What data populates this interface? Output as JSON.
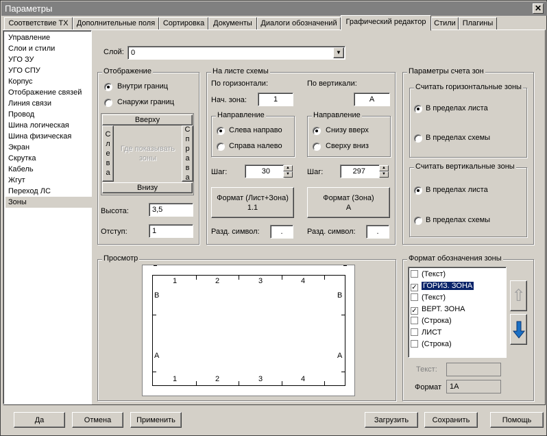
{
  "window": {
    "title": "Параметры",
    "close": "✕"
  },
  "tabs": [
    "Соответствие ТХ",
    "Дополнительные поля",
    "Сортировка",
    "Документы",
    "Диалоги обозначений",
    "Графический редактор",
    "Стили",
    "Плагины"
  ],
  "active_tab": "Графический редактор",
  "nav": [
    "Управление",
    "Слои и стили",
    "УГО ЗУ",
    "УГО СПУ",
    "Корпус",
    "Отображение связей",
    "Линия связи",
    "Провод",
    "Шина логическая",
    "Шина физическая",
    "Экран",
    "Скрутка",
    "Кабель",
    "Жгут",
    "Переход ЛС",
    "Зоны"
  ],
  "nav_selected": "Зоны",
  "layer": {
    "label": "Слой:",
    "value": "0"
  },
  "display": {
    "title": "Отображение",
    "inside": "Внутри границ",
    "outside": "Снаружи границ",
    "top": "Вверху",
    "left": "Слева",
    "right": "Справа",
    "bottom": "Внизу",
    "center": "Где показывать зоны",
    "height_label": "Высота:",
    "height_value": "3,5",
    "indent_label": "Отступ:",
    "indent_value": "1"
  },
  "sheet": {
    "title": "На листе схемы",
    "horiz": "По горизонтали:",
    "vert": "По вертикали:",
    "start_label": "Нач. зона:",
    "start_h": "1",
    "start_v": "A",
    "dir": "Направление",
    "l2r": "Слева направо",
    "r2l": "Справа налево",
    "b2t": "Снизу вверх",
    "t2b": "Сверху вниз",
    "step": "Шаг:",
    "step_h": "30",
    "step_v": "297",
    "fmt_h_title": "Формат (Лист+Зона)",
    "fmt_h_val": "1.1",
    "fmt_v_title": "Формат (Зона)",
    "fmt_v_val": "А",
    "sep": "Разд. символ:",
    "sep_h": ".",
    "sep_v": "."
  },
  "count": {
    "title": "Параметры счета зон",
    "horiz": "Считать горизонтальные зоны",
    "vert": "Считать вертикальные зоны",
    "in_sheet": "В пределах листа",
    "in_scheme": "В пределах схемы"
  },
  "preview": {
    "title": "Просмотр",
    "cols": [
      "1",
      "2",
      "3",
      "4"
    ],
    "rows": [
      "B",
      "A"
    ]
  },
  "zone_format": {
    "title": "Формат обозначения зоны",
    "items": [
      {
        "label": "(Текст)",
        "checked": false
      },
      {
        "label": "ГОРИЗ. ЗОНА",
        "checked": true,
        "selected": true
      },
      {
        "label": "(Текст)",
        "checked": false
      },
      {
        "label": "ВЕРТ. ЗОНА",
        "checked": true
      },
      {
        "label": "(Строка)",
        "checked": false
      },
      {
        "label": "ЛИСТ",
        "checked": false
      },
      {
        "label": "(Строка)",
        "checked": false
      }
    ],
    "text_label": "Текст:",
    "text_value": "",
    "format_label": "Формат",
    "format_value": "1A"
  },
  "buttons": {
    "ok": "Да",
    "cancel": "Отмена",
    "apply": "Применить",
    "load": "Загрузить",
    "save": "Сохранить",
    "help": "Помощь"
  }
}
